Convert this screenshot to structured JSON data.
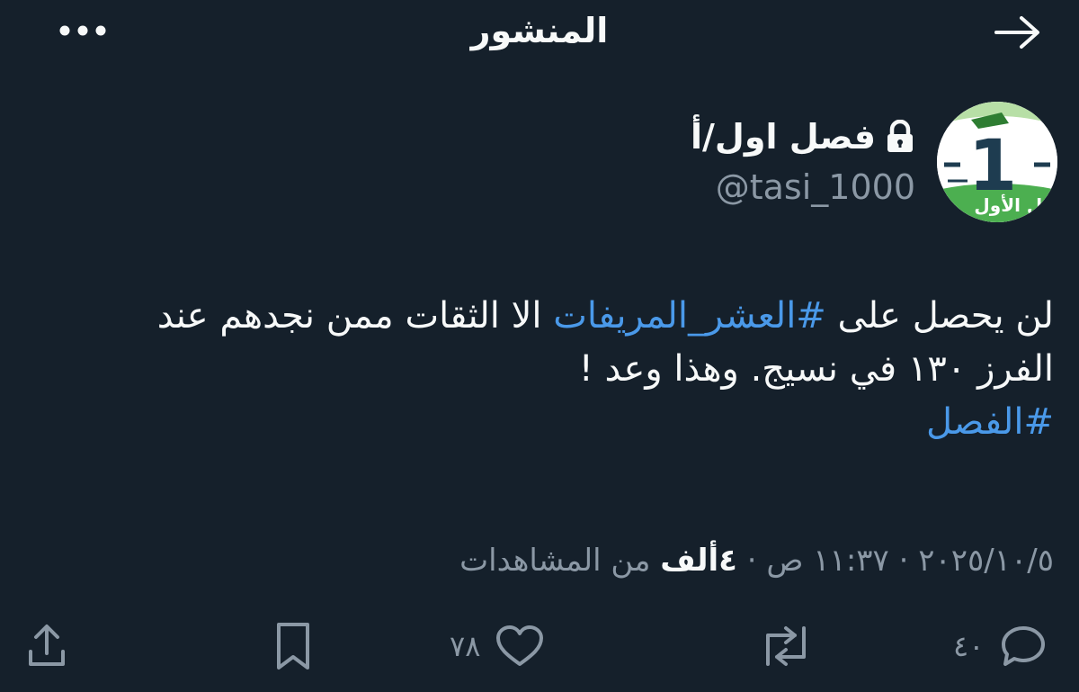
{
  "header": {
    "title": "المنشور"
  },
  "author": {
    "display_name": "فصل اول/أ",
    "handle": "@tasi_1000",
    "avatar_text": "1",
    "avatar_caption": "فصل الأول"
  },
  "tweet": {
    "segments": {
      "s1": "لن يحصل على ",
      "tag1": "#العشر_المريفات",
      "s2": " الا الثقات ممن نجدهم عند",
      "line2": "الفرز ١٣٠ في نسيج. وهذا وعد !",
      "tag2": "#الفصل"
    }
  },
  "meta": {
    "date": "٢٠٢٥/١٠/٥",
    "separator": " · ",
    "time": "١١:٣٧ ص",
    "views_count": "٤ألف",
    "views_label": " من المشاهدات"
  },
  "actions": {
    "replies_count": "٤٠",
    "likes_count": "٧٨"
  },
  "colors": {
    "background": "#15202b",
    "text": "#f7f9f9",
    "secondary": "#8b98a5",
    "accent": "#4a99e9"
  },
  "icons": {
    "back": "arrow-right-icon",
    "more": "more-dots-icon",
    "lock": "lock-icon",
    "reply": "reply-icon",
    "retweet": "retweet-icon",
    "like": "heart-icon",
    "bookmark": "bookmark-icon",
    "share": "share-icon"
  }
}
